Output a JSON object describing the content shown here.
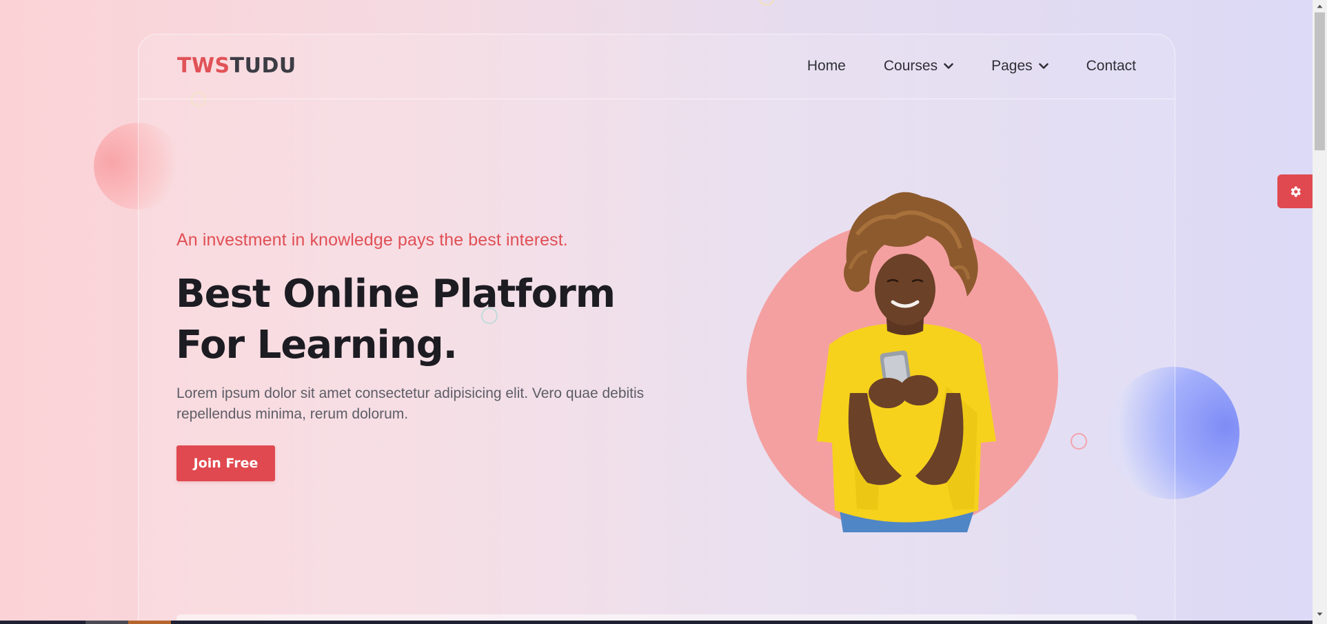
{
  "brand": {
    "logo_part1": "TWS",
    "logo_part2": "TUDU"
  },
  "nav": {
    "items": [
      {
        "label": "Home",
        "has_dropdown": false
      },
      {
        "label": "Courses",
        "has_dropdown": true
      },
      {
        "label": "Pages",
        "has_dropdown": true
      },
      {
        "label": "Contact",
        "has_dropdown": false
      }
    ]
  },
  "hero": {
    "tagline": "An investment in knowledge pays the best interest.",
    "title_line1": "Best Online Platform",
    "title_line2": "For Learning.",
    "description": "Lorem ipsum dolor sit amet consectetur adipisicing elit. Vero quae debitis repellendus minima, rerum dolorum.",
    "cta_label": "Join Free"
  },
  "icons": {
    "settings": "gear-icon",
    "dropdown": "chevron-down-icon"
  },
  "colors": {
    "accent": "#e0494f",
    "title": "#1c1c22",
    "circle": "#f4a0a1"
  }
}
